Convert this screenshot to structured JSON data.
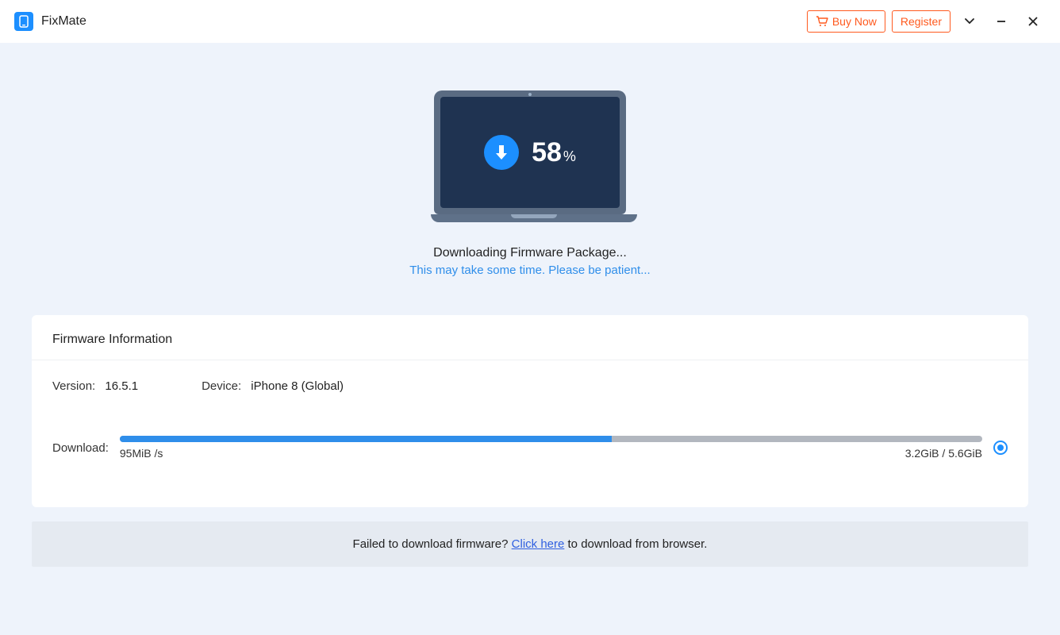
{
  "titlebar": {
    "app_name": "FixMate",
    "buy_label": "Buy Now",
    "register_label": "Register"
  },
  "progress": {
    "percent": "58",
    "percent_symbol": "%",
    "title": "Downloading Firmware Package...",
    "subtitle": "This may take some time. Please be patient..."
  },
  "firmware": {
    "section_title": "Firmware Information",
    "version_label": "Version:",
    "version_value": "16.5.1",
    "device_label": "Device:",
    "device_value": "iPhone 8 (Global)",
    "download_label": "Download:",
    "speed": "95MiB /s",
    "size": "3.2GiB / 5.6GiB",
    "progress_percent": 57
  },
  "footer": {
    "prefix": "Failed to download firmware? ",
    "link": "Click here",
    "suffix": " to download from browser."
  }
}
